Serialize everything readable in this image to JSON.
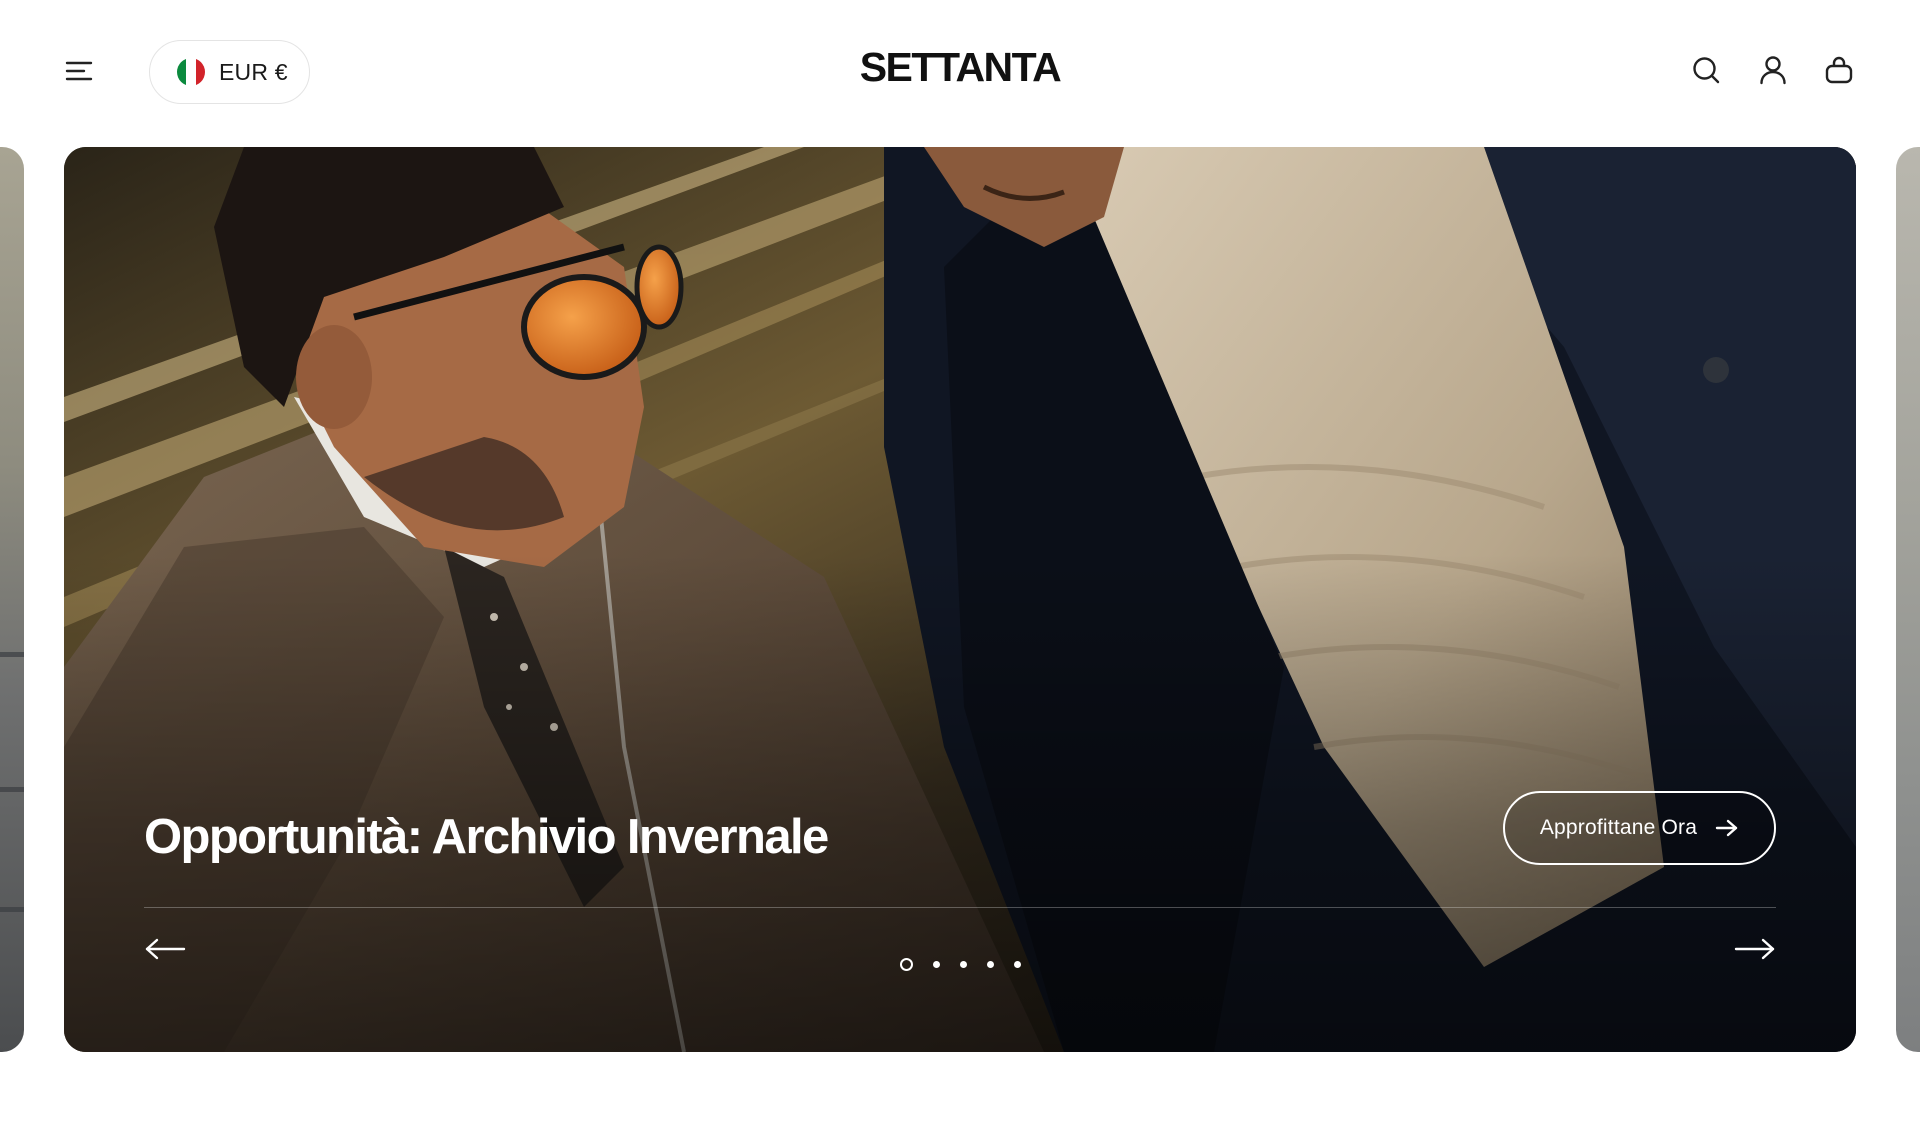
{
  "header": {
    "currency": {
      "label": "EUR €",
      "flag_colors": [
        "#0b8a3e",
        "#ffffff",
        "#d2232a"
      ]
    },
    "logo": "SETTANTA",
    "icons": [
      "menu-icon",
      "search-icon",
      "account-icon",
      "cart-icon"
    ]
  },
  "hero": {
    "title": "Opportunità: Archivio Invernale",
    "cta_label": "Approfittane Ora",
    "slides_total": 5,
    "active_slide": 1,
    "prev_icon": "arrow-left-icon",
    "next_icon": "arrow-right-icon"
  },
  "colors": {
    "text": "#111111",
    "hero_text": "#ffffff",
    "pill_border": "#e4e4e4"
  }
}
